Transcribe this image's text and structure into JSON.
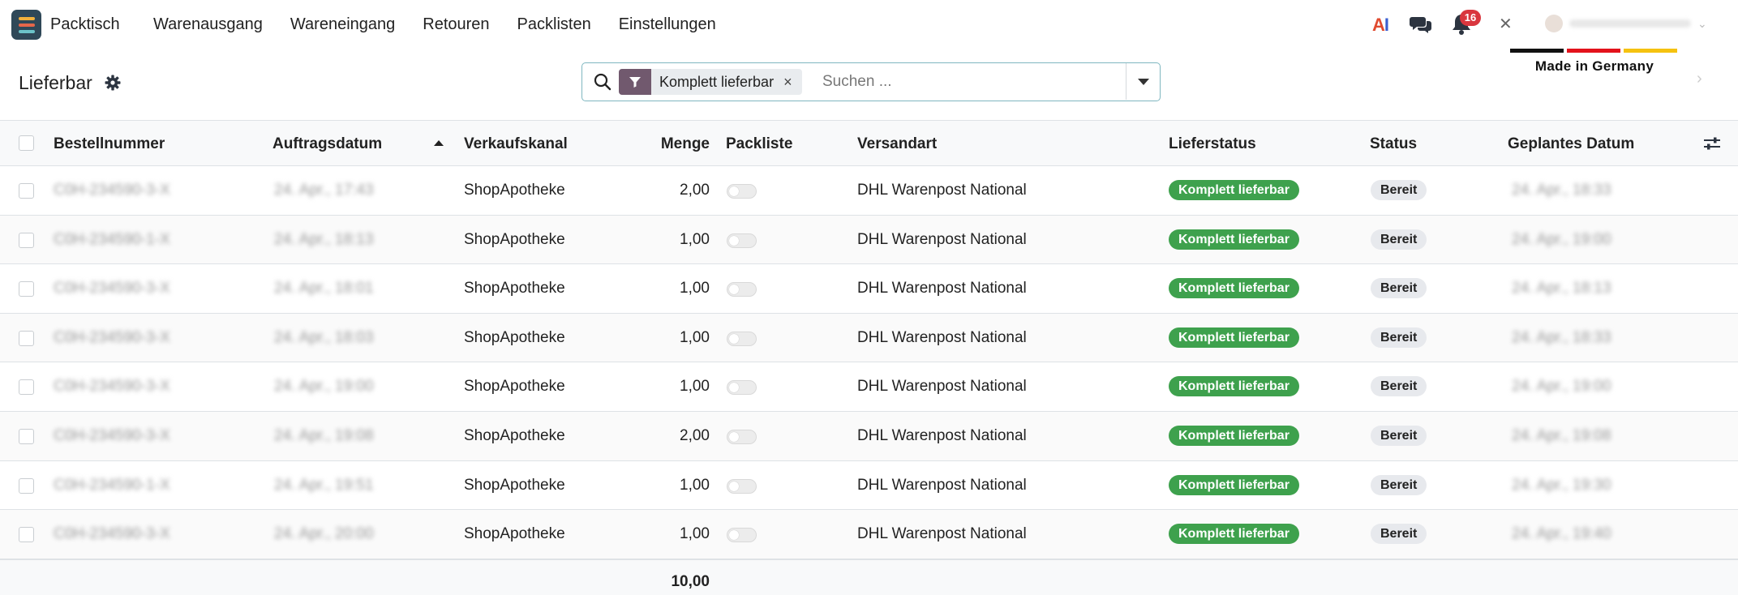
{
  "navbar": {
    "app_name": "Packtisch",
    "menu": [
      "Warenausgang",
      "Wareneingang",
      "Retouren",
      "Packlisten",
      "Einstellungen"
    ],
    "notification_count": "16",
    "ai_label_a": "A",
    "ai_label_i": "I",
    "close_glyph": "✕",
    "made_in": "Made in Germany"
  },
  "control_panel": {
    "title": "Lieferbar",
    "facet_label": "Komplett lieferbar",
    "facet_close": "×",
    "search_placeholder": "Suchen ..."
  },
  "table": {
    "columns": [
      "Bestellnummer",
      "Auftragsdatum",
      "Verkaufskanal",
      "Menge",
      "Packliste",
      "Versandart",
      "Lieferstatus",
      "Status",
      "Geplantes Datum"
    ],
    "rows": [
      {
        "order": "C0H-234590-3-X",
        "date": "24. Apr., 17:43",
        "channel": "ShopApotheke",
        "qty": "2,00",
        "shipping": "DHL Warenpost National",
        "delivery": "Komplett lieferbar",
        "status": "Bereit",
        "planned": "24. Apr., 18:33"
      },
      {
        "order": "C0H-234590-1-X",
        "date": "24. Apr., 18:13",
        "channel": "ShopApotheke",
        "qty": "1,00",
        "shipping": "DHL Warenpost National",
        "delivery": "Komplett lieferbar",
        "status": "Bereit",
        "planned": "24. Apr., 19:00"
      },
      {
        "order": "C0H-234590-3-X",
        "date": "24. Apr., 18:01",
        "channel": "ShopApotheke",
        "qty": "1,00",
        "shipping": "DHL Warenpost National",
        "delivery": "Komplett lieferbar",
        "status": "Bereit",
        "planned": "24. Apr., 18:13"
      },
      {
        "order": "C0H-234590-3-X",
        "date": "24. Apr., 18:03",
        "channel": "ShopApotheke",
        "qty": "1,00",
        "shipping": "DHL Warenpost National",
        "delivery": "Komplett lieferbar",
        "status": "Bereit",
        "planned": "24. Apr., 18:33"
      },
      {
        "order": "C0H-234590-3-X",
        "date": "24. Apr., 19:00",
        "channel": "ShopApotheke",
        "qty": "1,00",
        "shipping": "DHL Warenpost National",
        "delivery": "Komplett lieferbar",
        "status": "Bereit",
        "planned": "24. Apr., 19:00"
      },
      {
        "order": "C0H-234590-3-X",
        "date": "24. Apr., 19:08",
        "channel": "ShopApotheke",
        "qty": "2,00",
        "shipping": "DHL Warenpost National",
        "delivery": "Komplett lieferbar",
        "status": "Bereit",
        "planned": "24. Apr., 19:08"
      },
      {
        "order": "C0H-234590-1-X",
        "date": "24. Apr., 19:51",
        "channel": "ShopApotheke",
        "qty": "1,00",
        "shipping": "DHL Warenpost National",
        "delivery": "Komplett lieferbar",
        "status": "Bereit",
        "planned": "24. Apr., 19:30"
      },
      {
        "order": "C0H-234590-3-X",
        "date": "24. Apr., 20:00",
        "channel": "ShopApotheke",
        "qty": "1,00",
        "shipping": "DHL Warenpost National",
        "delivery": "Komplett lieferbar",
        "status": "Bereit",
        "planned": "24. Apr., 19:40"
      }
    ],
    "total_qty": "10,00"
  },
  "colors": {
    "facet_icon_bg": "#71596e",
    "badge_green": "#3ea14d",
    "badge_notification": "#d9363e",
    "search_border": "#7fb7c0"
  },
  "icons": {
    "app": "app-icon",
    "chat": "chat-icon",
    "bell": "bell-icon",
    "search": "search-icon",
    "filter": "filter-icon",
    "gear": "gear-icon",
    "column_settings": "sliders-icon"
  }
}
